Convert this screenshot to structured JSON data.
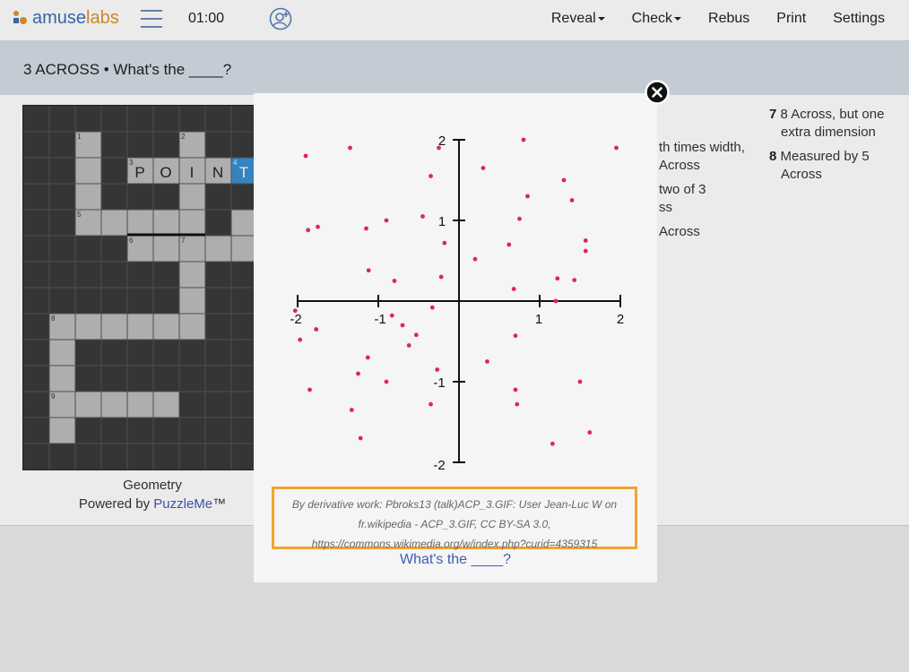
{
  "header": {
    "logo": {
      "part1": "amuse",
      "part2": "labs"
    },
    "timer": "01:00",
    "menu": [
      {
        "label": "Reveal",
        "dropdown": true
      },
      {
        "label": "Check",
        "dropdown": true
      },
      {
        "label": "Rebus",
        "dropdown": false
      },
      {
        "label": "Print",
        "dropdown": false
      },
      {
        "label": "Settings",
        "dropdown": false
      }
    ]
  },
  "current_clue": {
    "text": "3 ACROSS • What's the ____?"
  },
  "grid": {
    "numbers": [
      "1",
      "2",
      "3",
      "4",
      "5",
      "6",
      "7",
      "8",
      "9"
    ],
    "letters": [
      "P",
      "O",
      "I",
      "N",
      "T"
    ]
  },
  "puzzle_footer": {
    "title": "Geometry",
    "powered_by": "Powered by",
    "brand": "PuzzleMe",
    "tm": "™"
  },
  "clues_partial": {
    "c1": "th times width,",
    "c2": "Across",
    "c3": "two of 3",
    "c4": "ss",
    "c5": "Across"
  },
  "clues_right": [
    {
      "num": "7",
      "line1": "8 Across, but one",
      "line2": "extra dimension"
    },
    {
      "num": "8",
      "line1": "Measured by 5",
      "line2": "Across"
    }
  ],
  "modal": {
    "credit_line1": "By derivative work: Pbroks13 (talk)ACP_3.GIF: User Jean-Luc W on",
    "credit_line2": "fr.wikipedia - ACP_3.GIF, CC BY-SA 3.0,",
    "credit_line3": "https://commons.wikimedia.org/w/index.php?curid=4359315",
    "link": "What's the ____?"
  },
  "colors": {
    "point": "#e0245e",
    "brand_blue": "#3b6fb4",
    "brand_orange": "#e2922c",
    "highlight_border": "#f0a430",
    "selected_cell": "#3a8fd1"
  },
  "chart_data": {
    "type": "scatter",
    "x_ticks": [
      "-2",
      "-1",
      "1",
      "2"
    ],
    "y_ticks": [
      "2",
      "1",
      "-1",
      "-2"
    ],
    "xlim": [
      -2,
      2
    ],
    "ylim": [
      -2,
      2
    ],
    "grid": false,
    "points": [
      [
        -1.9,
        1.8
      ],
      [
        -1.35,
        1.9
      ],
      [
        0.8,
        2.0
      ],
      [
        1.95,
        1.9
      ],
      [
        0.3,
        1.65
      ],
      [
        -0.35,
        1.55
      ],
      [
        1.3,
        1.5
      ],
      [
        0.85,
        1.3
      ],
      [
        1.4,
        1.25
      ],
      [
        -0.25,
        1.9
      ],
      [
        -0.45,
        1.05
      ],
      [
        -0.9,
        1.0
      ],
      [
        -1.15,
        0.9
      ],
      [
        -1.75,
        0.92
      ],
      [
        -1.87,
        0.88
      ],
      [
        0.75,
        1.02
      ],
      [
        -0.18,
        0.72
      ],
      [
        0.62,
        0.7
      ],
      [
        1.57,
        0.75
      ],
      [
        1.57,
        0.62
      ],
      [
        0.2,
        0.52
      ],
      [
        -1.12,
        0.38
      ],
      [
        -0.8,
        0.25
      ],
      [
        -0.22,
        0.3
      ],
      [
        1.22,
        0.28
      ],
      [
        1.43,
        0.26
      ],
      [
        0.68,
        0.15
      ],
      [
        1.2,
        0.0
      ],
      [
        -0.33,
        -0.08
      ],
      [
        -0.83,
        -0.18
      ],
      [
        -0.7,
        -0.3
      ],
      [
        -0.53,
        -0.42
      ],
      [
        -0.62,
        -0.55
      ],
      [
        -2.03,
        -0.12
      ],
      [
        -1.97,
        -0.48
      ],
      [
        -1.77,
        -0.35
      ],
      [
        0.7,
        -0.43
      ],
      [
        -1.13,
        -0.7
      ],
      [
        0.35,
        -0.75
      ],
      [
        -1.25,
        -0.9
      ],
      [
        -0.27,
        -0.85
      ],
      [
        -0.9,
        -1.0
      ],
      [
        1.5,
        -1.0
      ],
      [
        0.7,
        -1.1
      ],
      [
        -1.85,
        -1.1
      ],
      [
        0.72,
        -1.28
      ],
      [
        -0.35,
        -1.28
      ],
      [
        -1.33,
        -1.35
      ],
      [
        1.62,
        -1.63
      ],
      [
        -1.22,
        -1.7
      ],
      [
        1.16,
        -1.77
      ]
    ]
  }
}
